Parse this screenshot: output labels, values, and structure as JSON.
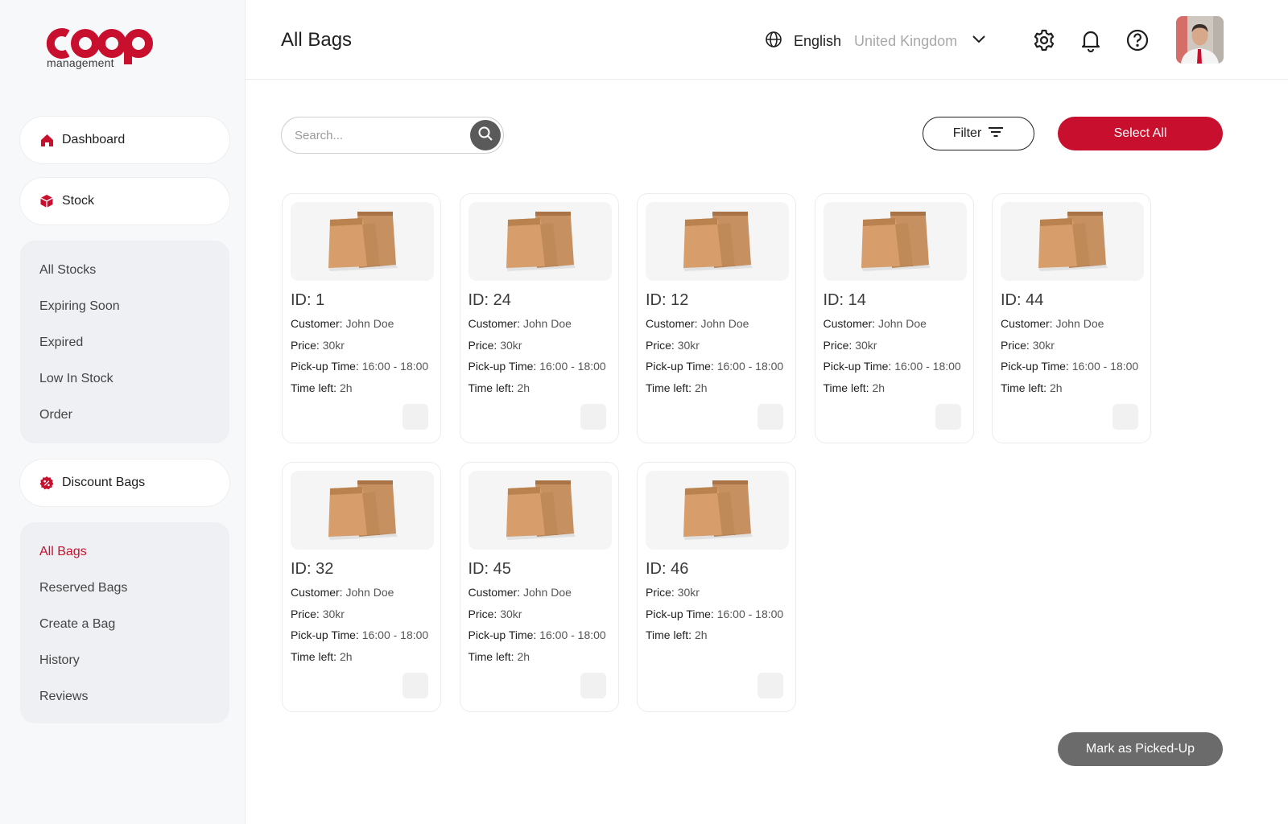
{
  "brand": {
    "logo_text": "coop",
    "logo_sub": "management",
    "color": "#c8102e"
  },
  "sidebar": {
    "dashboard": {
      "label": "Dashboard",
      "icon": "home-icon"
    },
    "stock": {
      "label": "Stock",
      "icon": "box-icon"
    },
    "stock_items": [
      "All Stocks",
      "Expiring Soon",
      "Expired",
      "Low In Stock",
      "Order"
    ],
    "discount": {
      "label": "Discount Bags",
      "icon": "discount-badge-icon"
    },
    "discount_items": [
      "All Bags",
      "Reserved Bags",
      "Create a Bag",
      "History",
      "Reviews"
    ],
    "active_item": "All Bags"
  },
  "header": {
    "title": "All Bags",
    "language": "English",
    "region": "United Kingdom",
    "icons": [
      "globe-icon",
      "gear-icon",
      "bell-icon",
      "help-icon",
      "chevron-down-icon"
    ]
  },
  "toolbar": {
    "search_placeholder": "Search...",
    "filter_label": "Filter",
    "select_all_label": "Select All"
  },
  "labels": {
    "customer": "Customer:",
    "price": "Price:",
    "pickup": "Pick-up Time:",
    "time_left": "Time left:"
  },
  "bags": [
    {
      "id": "ID: 1",
      "customer": "John Doe",
      "price": "30kr",
      "pickup": "16:00 - 18:00",
      "time_left": "2h"
    },
    {
      "id": "ID: 24",
      "customer": "John Doe",
      "price": "30kr",
      "pickup": "16:00 - 18:00",
      "time_left": "2h"
    },
    {
      "id": "ID: 12",
      "customer": "John Doe",
      "price": "30kr",
      "pickup": "16:00 - 18:00",
      "time_left": "2h"
    },
    {
      "id": "ID: 14",
      "customer": "John Doe",
      "price": "30kr",
      "pickup": "16:00 - 18:00",
      "time_left": "2h"
    },
    {
      "id": "ID: 44",
      "customer": "John Doe",
      "price": "30kr",
      "pickup": "16:00 - 18:00",
      "time_left": "2h"
    },
    {
      "id": "ID: 32",
      "customer": "John Doe",
      "price": "30kr",
      "pickup": "16:00 - 18:00",
      "time_left": "2h"
    },
    {
      "id": "ID: 45",
      "customer": "John Doe",
      "price": "30kr",
      "pickup": "16:00 - 18:00",
      "time_left": "2h"
    },
    {
      "id": "ID: 46",
      "price": "30kr",
      "pickup": "16:00 - 18:00",
      "time_left": "2h"
    }
  ],
  "actions": {
    "mark_picked_up": "Mark as Picked-Up"
  }
}
